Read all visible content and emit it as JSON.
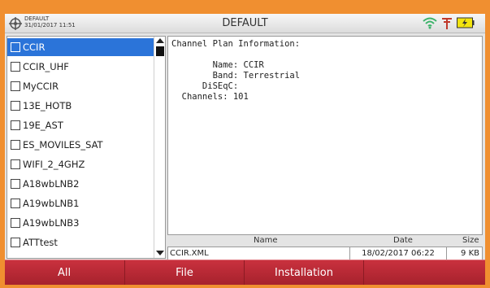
{
  "status_bar": {
    "preset_name": "DEFAULT",
    "datetime": "31/01/2017 11:51",
    "title": "DEFAULT",
    "icons": [
      "satellite-icon",
      "wifi-icon",
      "antenna-icon",
      "battery-icon"
    ]
  },
  "channel_plans": [
    {
      "label": "CCIR",
      "selected": true
    },
    {
      "label": "CCIR_UHF"
    },
    {
      "label": "MyCCIR"
    },
    {
      "label": "13E_HOTB"
    },
    {
      "label": "19E_AST"
    },
    {
      "label": "ES_MOVILES_SAT"
    },
    {
      "label": "WIFI_2_4GHZ"
    },
    {
      "label": "A18wbLNB2"
    },
    {
      "label": "A19wbLNB1"
    },
    {
      "label": "A19wbLNB3"
    },
    {
      "label": "ATTtest"
    }
  ],
  "info": {
    "heading": "Channel Plan Information:",
    "text": "Channel Plan Information:\n\n        Name: CCIR\n        Band: Terrestrial\n      DiSEqC:\n  Channels: 101"
  },
  "file_table": {
    "columns": {
      "name": "Name",
      "date": "Date",
      "size": "Size"
    },
    "rows": [
      {
        "name": "CCIR.XML",
        "date": "18/02/2017 06:22",
        "size": "9 KB"
      }
    ]
  },
  "softkeys": [
    "All",
    "File",
    "Installation",
    ""
  ],
  "colors": {
    "frame": "#f08f30",
    "selection": "#2b74d9",
    "softkey_bar": "#b32632",
    "battery": "#f2e40f"
  }
}
